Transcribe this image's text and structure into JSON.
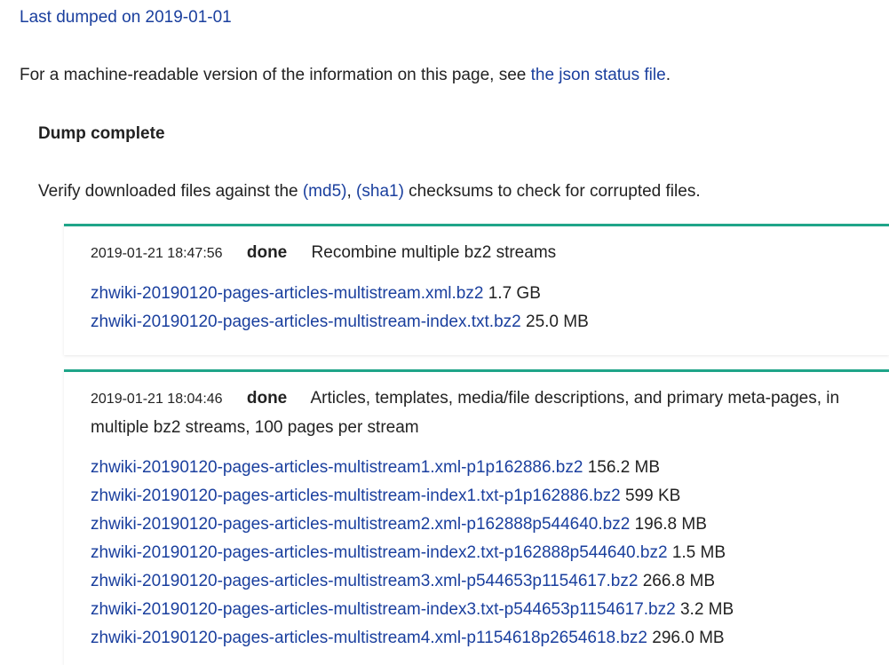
{
  "header": {
    "last_dumped": "Last dumped on 2019-01-01",
    "json_note_prefix": "For a machine-readable version of the information on this page, see ",
    "json_link": "the json status file",
    "json_note_suffix": "."
  },
  "status": {
    "heading": "Dump complete",
    "verify_prefix": "Verify downloaded files against the ",
    "md5_link": "(md5)",
    "verify_comma": ", ",
    "sha1_link": "(sha1)",
    "verify_suffix": " checksums to check for corrupted files."
  },
  "jobs": [
    {
      "time": "2019-01-21 18:47:56",
      "status": "done",
      "description": "Recombine multiple bz2 streams",
      "files": [
        {
          "name": "zhwiki-20190120-pages-articles-multistream.xml.bz2",
          "size": "1.7 GB"
        },
        {
          "name": "zhwiki-20190120-pages-articles-multistream-index.txt.bz2",
          "size": "25.0 MB"
        }
      ]
    },
    {
      "time": "2019-01-21 18:04:46",
      "status": "done",
      "description": "Articles, templates, media/file descriptions, and primary meta-pages, in multiple bz2 streams, 100 pages per stream",
      "files": [
        {
          "name": "zhwiki-20190120-pages-articles-multistream1.xml-p1p162886.bz2",
          "size": "156.2 MB"
        },
        {
          "name": "zhwiki-20190120-pages-articles-multistream-index1.txt-p1p162886.bz2",
          "size": "599 KB"
        },
        {
          "name": "zhwiki-20190120-pages-articles-multistream2.xml-p162888p544640.bz2",
          "size": "196.8 MB"
        },
        {
          "name": "zhwiki-20190120-pages-articles-multistream-index2.txt-p162888p544640.bz2",
          "size": "1.5 MB"
        },
        {
          "name": "zhwiki-20190120-pages-articles-multistream3.xml-p544653p1154617.bz2",
          "size": "266.8 MB"
        },
        {
          "name": "zhwiki-20190120-pages-articles-multistream-index3.txt-p544653p1154617.bz2",
          "size": "3.2 MB"
        },
        {
          "name": "zhwiki-20190120-pages-articles-multistream4.xml-p1154618p2654618.bz2",
          "size": "296.0 MB"
        }
      ]
    }
  ],
  "colors": {
    "link": "#1a3f9e",
    "accent_border": "#1fa589",
    "text": "#222222"
  }
}
